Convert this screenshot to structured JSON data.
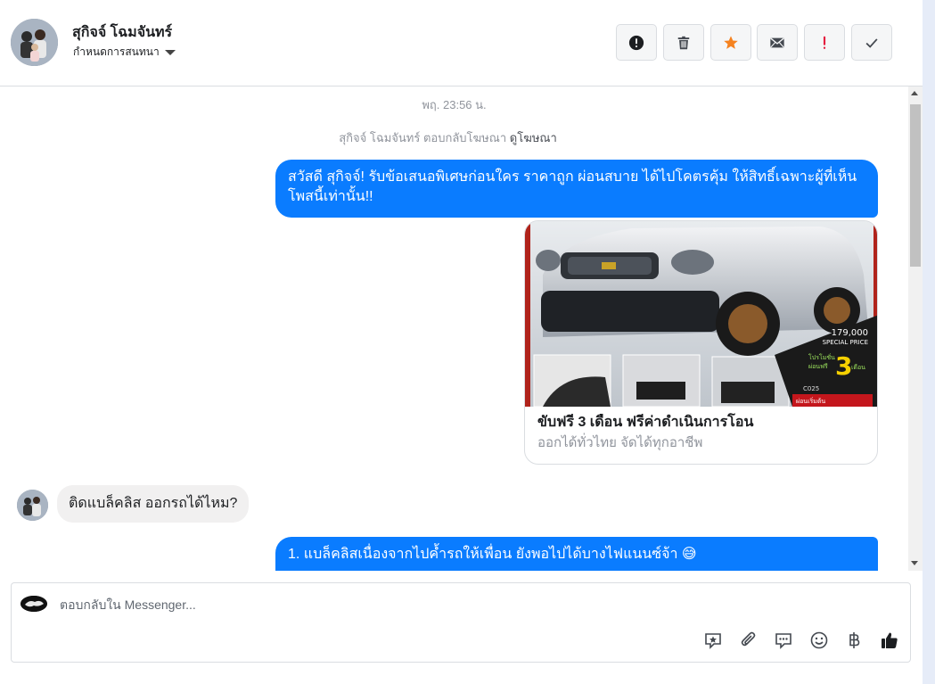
{
  "header": {
    "contact_name": "สุกิจจ์ โฉมจันทร์",
    "conversation_settings_label": "กำหนดการสนทนา",
    "actions": [
      {
        "icon": "alert-circle-icon",
        "color": "#1c1e21"
      },
      {
        "icon": "trash-icon",
        "color": "#444950"
      },
      {
        "icon": "star-icon",
        "color": "#f5821f"
      },
      {
        "icon": "envelope-icon",
        "color": "#444950"
      },
      {
        "icon": "exclamation-icon",
        "color": "#e41e3f"
      },
      {
        "icon": "checkmark-icon",
        "color": "#444950"
      }
    ]
  },
  "thread": {
    "timestamp": "พฤ. 23:56 น.",
    "reply_note": {
      "text": "สุกิจจ์ โฉมจันทร์ ตอบกลับโฆษณา",
      "link": "ดูโฆษณา"
    },
    "messages": [
      {
        "from": "page",
        "text": "สวัสดี สุกิจจ์! รับข้อเสนอพิเศษก่อนใคร ราคาถูก ผ่อนสบาย ได้ไปโคตรคุ้ม ให้สิทธิ์เฉพาะผู้ที่เห็นโพสนี้เท่านั้น!!"
      },
      {
        "from": "page",
        "type": "ad_card",
        "title": "ขับฟรี 3 เดือน ฟรีค่าดำเนินการโอน",
        "subtitle": "ออกได้ทั่วไทย จัดได้ทุกอาชีพ",
        "image_text": {
          "price": "179,000",
          "price_label": "SPECIAL PRICE",
          "promo_prefix": "โปรโมชั่น",
          "promo_free": "ผ่อนฟรี",
          "promo_number": "3",
          "promo_unit": "เดือน",
          "code": "C025",
          "badge": "ผ่อนเริ่มต้น"
        }
      },
      {
        "from": "customer",
        "text": "ติดแบล็คลิส ออกรถได้ไหม?"
      },
      {
        "from": "page",
        "text": "1. แบล็คลิสเนื่องจากไปค้ำรถให้เพื่อน ยังพอไปได้บางไฟแนนซ์จ้า 😅"
      }
    ]
  },
  "composer": {
    "placeholder": "ตอบกลับใน Messenger...",
    "tools": [
      "saved-reply-icon",
      "attachment-icon",
      "quick-reply-icon",
      "emoji-icon",
      "baht-icon",
      "thumbs-up-icon"
    ]
  },
  "colors": {
    "accent_bubble": "#0a7cff",
    "incoming_bubble": "#f1f0f0"
  }
}
